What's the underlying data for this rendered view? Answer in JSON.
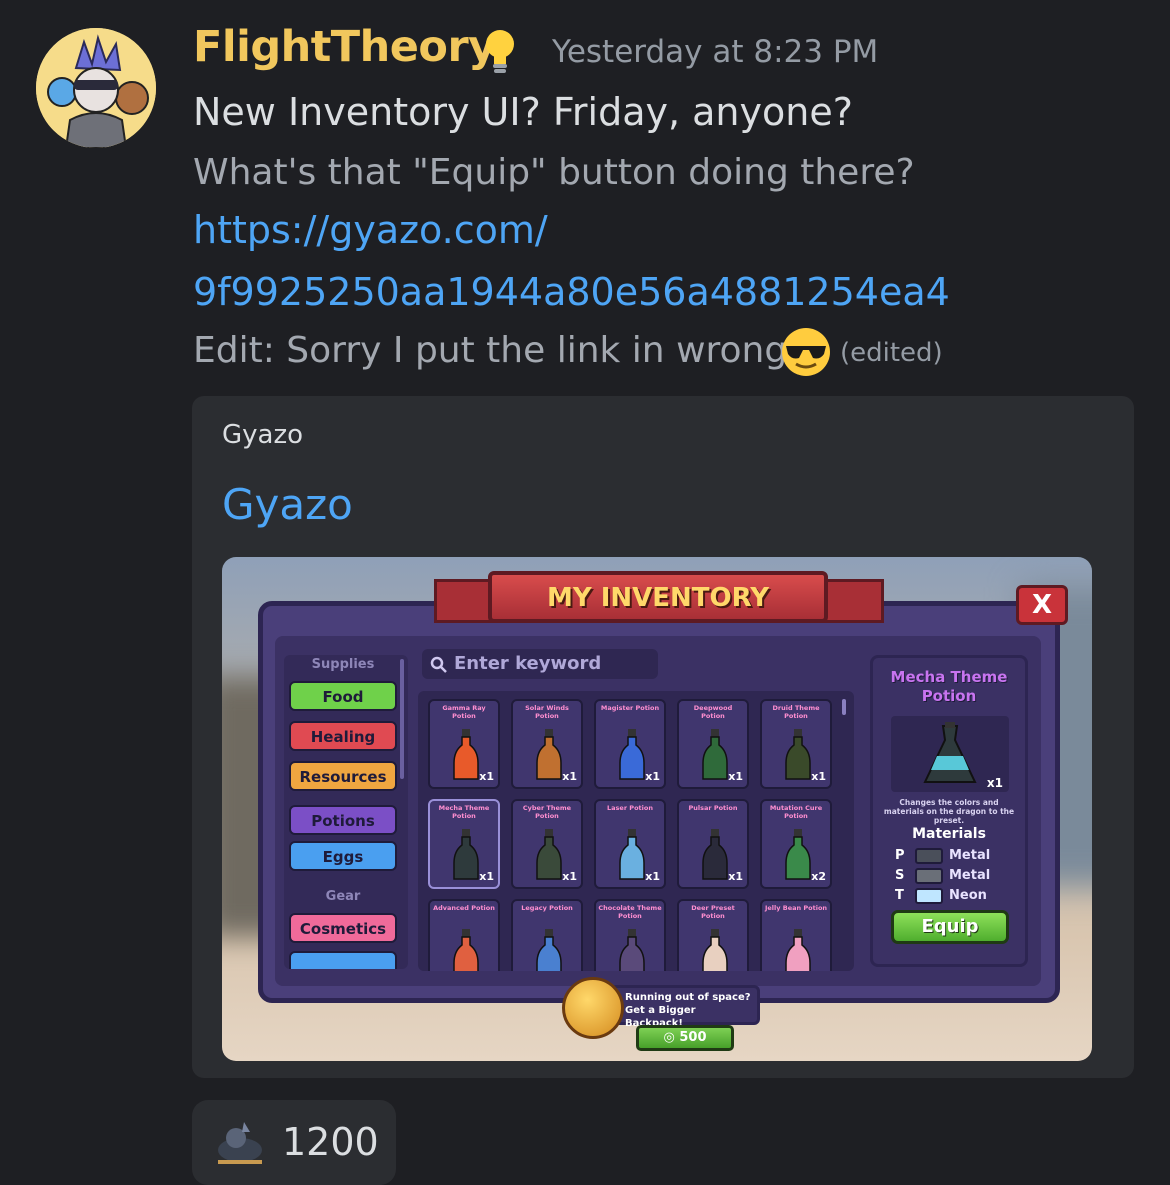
{
  "message": {
    "username": "FlightTheory",
    "timestamp": "Yesterday at 8:23 PM",
    "line1": "New Inventory UI? Friday, anyone?",
    "line2": "What's that \"Equip\" button doing there?",
    "link_part1": "https://gyazo.com/",
    "link_part2": "9f9925250aa1944a80e56a4881254ea4",
    "line5": "Edit: Sorry I put the link in wrong",
    "edited_label": "(edited)",
    "username_color": "#f1c75d",
    "link_color": "#4ea5f5"
  },
  "embed": {
    "provider": "Gyazo",
    "title": "Gyazo"
  },
  "game": {
    "inventory_title": "MY INVENTORY",
    "close_label": "X",
    "section_supplies": "Supplies",
    "section_gear": "Gear",
    "categories": [
      {
        "label": "Food",
        "color": "#6fd14a"
      },
      {
        "label": "Healing",
        "color": "#e04a52"
      },
      {
        "label": "Resources",
        "color": "#f0a640"
      },
      {
        "label": "Potions",
        "color": "#7b4fc6"
      },
      {
        "label": "Eggs",
        "color": "#4a9ff0"
      },
      {
        "label": "Cosmetics",
        "color": "#f06a9a"
      }
    ],
    "search_placeholder": "Enter keyword",
    "items": [
      {
        "name": "Gamma Ray Potion",
        "qty": "x1"
      },
      {
        "name": "Solar Winds Potion",
        "qty": "x1"
      },
      {
        "name": "Magister Potion",
        "qty": "x1"
      },
      {
        "name": "Deepwood Potion",
        "qty": "x1"
      },
      {
        "name": "Druid Theme Potion",
        "qty": "x1"
      },
      {
        "name": "Mecha Theme Potion",
        "qty": "x1"
      },
      {
        "name": "Cyber Theme Potion",
        "qty": "x1"
      },
      {
        "name": "Laser Potion",
        "qty": "x1"
      },
      {
        "name": "Pulsar Potion",
        "qty": "x1"
      },
      {
        "name": "Mutation Cure Potion",
        "qty": "x2"
      },
      {
        "name": "Advanced Potion",
        "qty": ""
      },
      {
        "name": "Legacy Potion",
        "qty": ""
      },
      {
        "name": "Chocolate Theme Potion",
        "qty": ""
      },
      {
        "name": "Deer Preset Potion",
        "qty": ""
      },
      {
        "name": "Jelly Bean Potion",
        "qty": ""
      }
    ],
    "detail": {
      "title": "Mecha Theme Potion",
      "qty": "x1",
      "description": "Changes the colors and materials on the dragon to the preset.",
      "materials_label": "Materials",
      "materials": [
        {
          "key": "P",
          "value": "Metal",
          "color": "#4a4f5a"
        },
        {
          "key": "S",
          "value": "Metal",
          "color": "#6a6f78"
        },
        {
          "key": "T",
          "value": "Neon",
          "color": "#bfe6ff"
        }
      ],
      "equip_label": "Equip"
    },
    "promo": {
      "line1": "Running out of space?",
      "line2": "Get a Bigger Backpack!",
      "price": "500"
    }
  },
  "reaction": {
    "count": "1200"
  }
}
